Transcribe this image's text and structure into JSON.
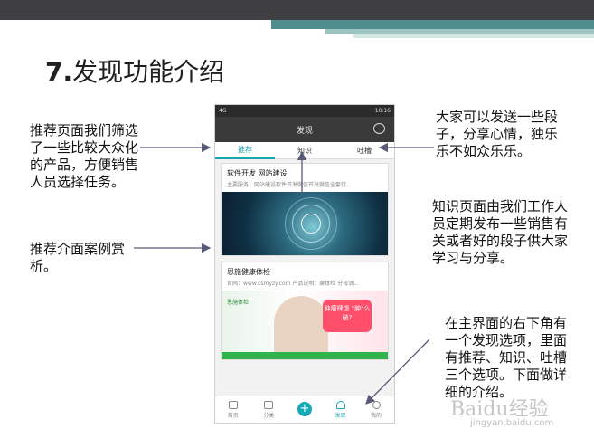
{
  "slide": {
    "title_num": "7.",
    "title_text": "发现功能介绍",
    "callouts": {
      "left1": "推荐页面我们筛选了一些比较大众化的产品，方便销售人员选择任务。",
      "left2": "推荐介面案例赏析。",
      "right1": "大家可以发送一些段子，分享心情，独乐乐不如众乐乐。",
      "right2": "知识页面由我们工作人员定期发布一些销售有关或者好的段子供大家学习与分享。",
      "right3": "在主界面的右下角有一个发现选项，里面有推荐、知识、吐槽三个选项。下面做详细的介绍。"
    },
    "watermark": "Baidu经验",
    "watermark_url": "jingyan.baidu.com"
  },
  "phone": {
    "status_left": "4G",
    "status_right": "10:16",
    "header_title": "发现",
    "tabs": [
      "推荐",
      "知识",
      "吐槽"
    ],
    "cards": [
      {
        "title": "软件开发 网站建设",
        "subtitle": "主要服务：网站建设软件开发微信开发微信全套行..."
      },
      {
        "title": "恩施健康体检",
        "subtitle": "官网：www.csmyzy.com 产品说明：聊体检 分母油..."
      }
    ],
    "banner_brand": "恩施体检",
    "banner_bubble": "肿瘤肆虐 \"肿\"么破?",
    "nav": [
      "首页",
      "分类",
      "",
      "发现",
      "我的"
    ]
  },
  "colors": {
    "accent": "#1aa3b0",
    "header_dark": "#3a3a3a",
    "slide_band": "#3f3f44",
    "slide_stripe": "#4e8f8e"
  }
}
